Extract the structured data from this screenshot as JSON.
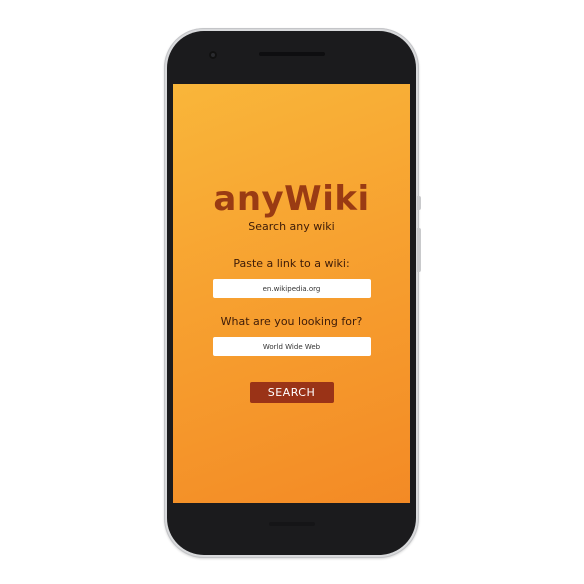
{
  "app": {
    "title": "anyWiki",
    "subtitle": "Search any wiki"
  },
  "form": {
    "wiki_label": "Paste a link to a wiki:",
    "wiki_value": "en.wikipedia.org",
    "query_label": "What are you looking for?",
    "query_value": "World Wide Web",
    "search_button_label": "SEARCH"
  },
  "colors": {
    "gradient_start": "#f9b63a",
    "gradient_end": "#f38a25",
    "title_color": "#9a3b13",
    "button_bg": "#9a3317",
    "phone_bezel": "#1b1b1d"
  }
}
